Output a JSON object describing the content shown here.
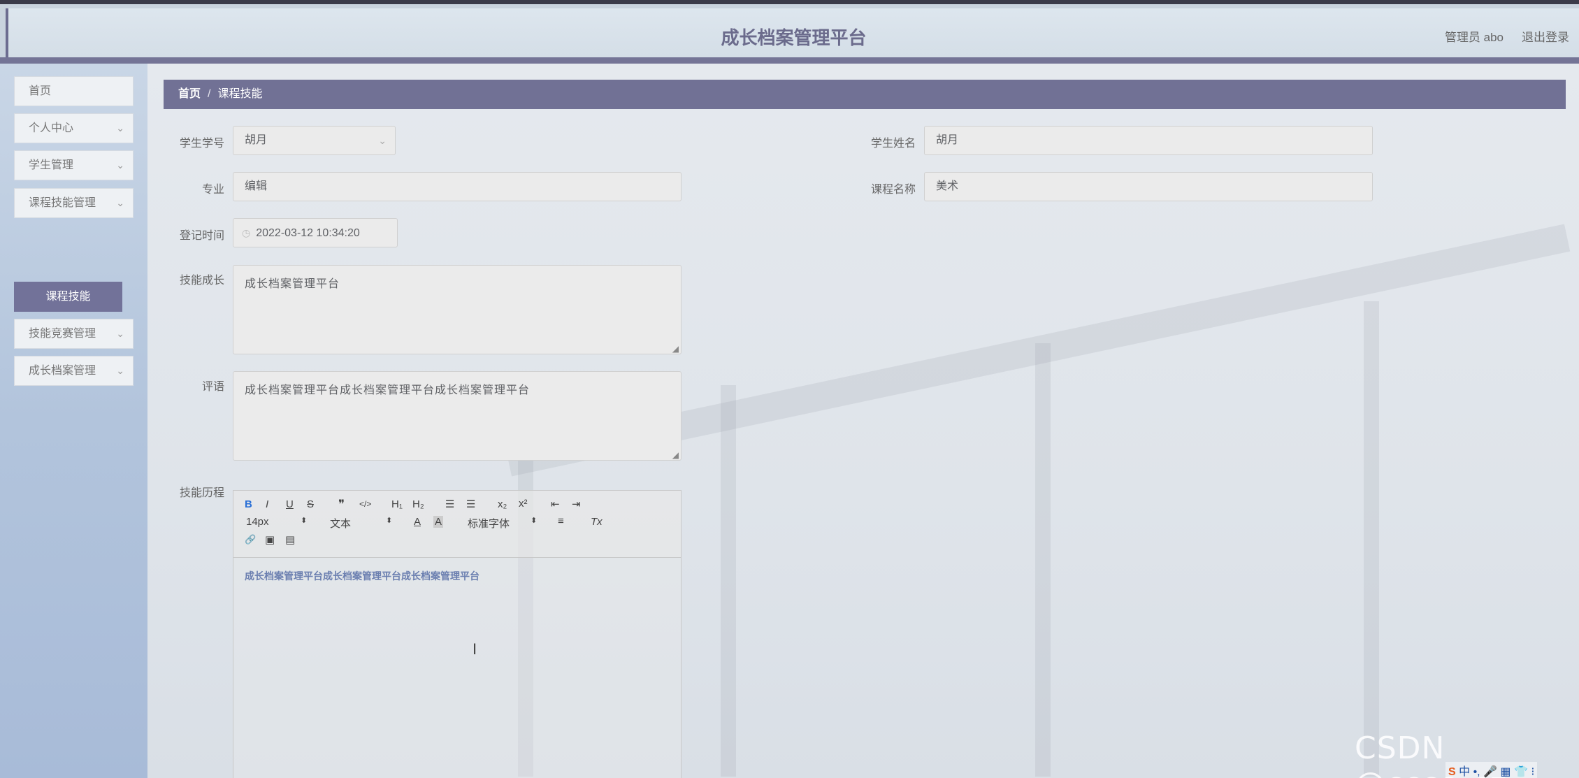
{
  "header": {
    "title": "成长档案管理平台",
    "user_label": "管理员 abo",
    "logout_label": "退出登录"
  },
  "sidebar": {
    "items": [
      {
        "label": "首页",
        "has_chevron": false
      },
      {
        "label": "个人中心",
        "has_chevron": true
      },
      {
        "label": "学生管理",
        "has_chevron": true
      },
      {
        "label": "课程技能管理",
        "has_chevron": true
      },
      {
        "label": "技能竞赛管理",
        "has_chevron": true
      },
      {
        "label": "成长档案管理",
        "has_chevron": true
      }
    ],
    "active_sub": "课程技能",
    "chevron": "⌄"
  },
  "breadcrumb": {
    "home": "首页",
    "separator": "/",
    "current": "课程技能"
  },
  "form": {
    "student_no_label": "学生学号",
    "student_no_value": "胡月",
    "student_name_label": "学生姓名",
    "student_name_value": "胡月",
    "major_label": "专业",
    "major_value": "编辑",
    "course_label": "课程名称",
    "course_value": "美术",
    "time_label": "登记时间",
    "time_value": "2022-03-12 10:34:20",
    "growth_label": "技能成长",
    "growth_value": "成长档案管理平台",
    "comment_label": "评语",
    "comment_value": "成长档案管理平台成长档案管理平台成长档案管理平台",
    "history_label": "技能历程",
    "history_content": "成长档案管理平台成长档案管理平台成长档案管理平台"
  },
  "editor_toolbar": {
    "bold": "B",
    "italic": "I",
    "underline": "U",
    "strike": "S",
    "quote": "❞",
    "code": "</>",
    "h1": "H₁",
    "h2": "H₂",
    "ordered_list": "☰",
    "bullet_list": "☰",
    "subscript": "x₂",
    "superscript": "x²",
    "outdent": "⇤",
    "indent": "⇥",
    "size_value": "14px",
    "block_value": "文本",
    "font_color": "A",
    "bg_color": "A",
    "font_value": "标准字体",
    "align": "≡",
    "clear": "Tx",
    "link": "🔗",
    "image": "▣",
    "video": "▤"
  },
  "watermark": "CSDN @cccc_cz",
  "ime": {
    "logo": "S",
    "text": "中 •, 🎤 ▦ 👕 ⁝"
  }
}
